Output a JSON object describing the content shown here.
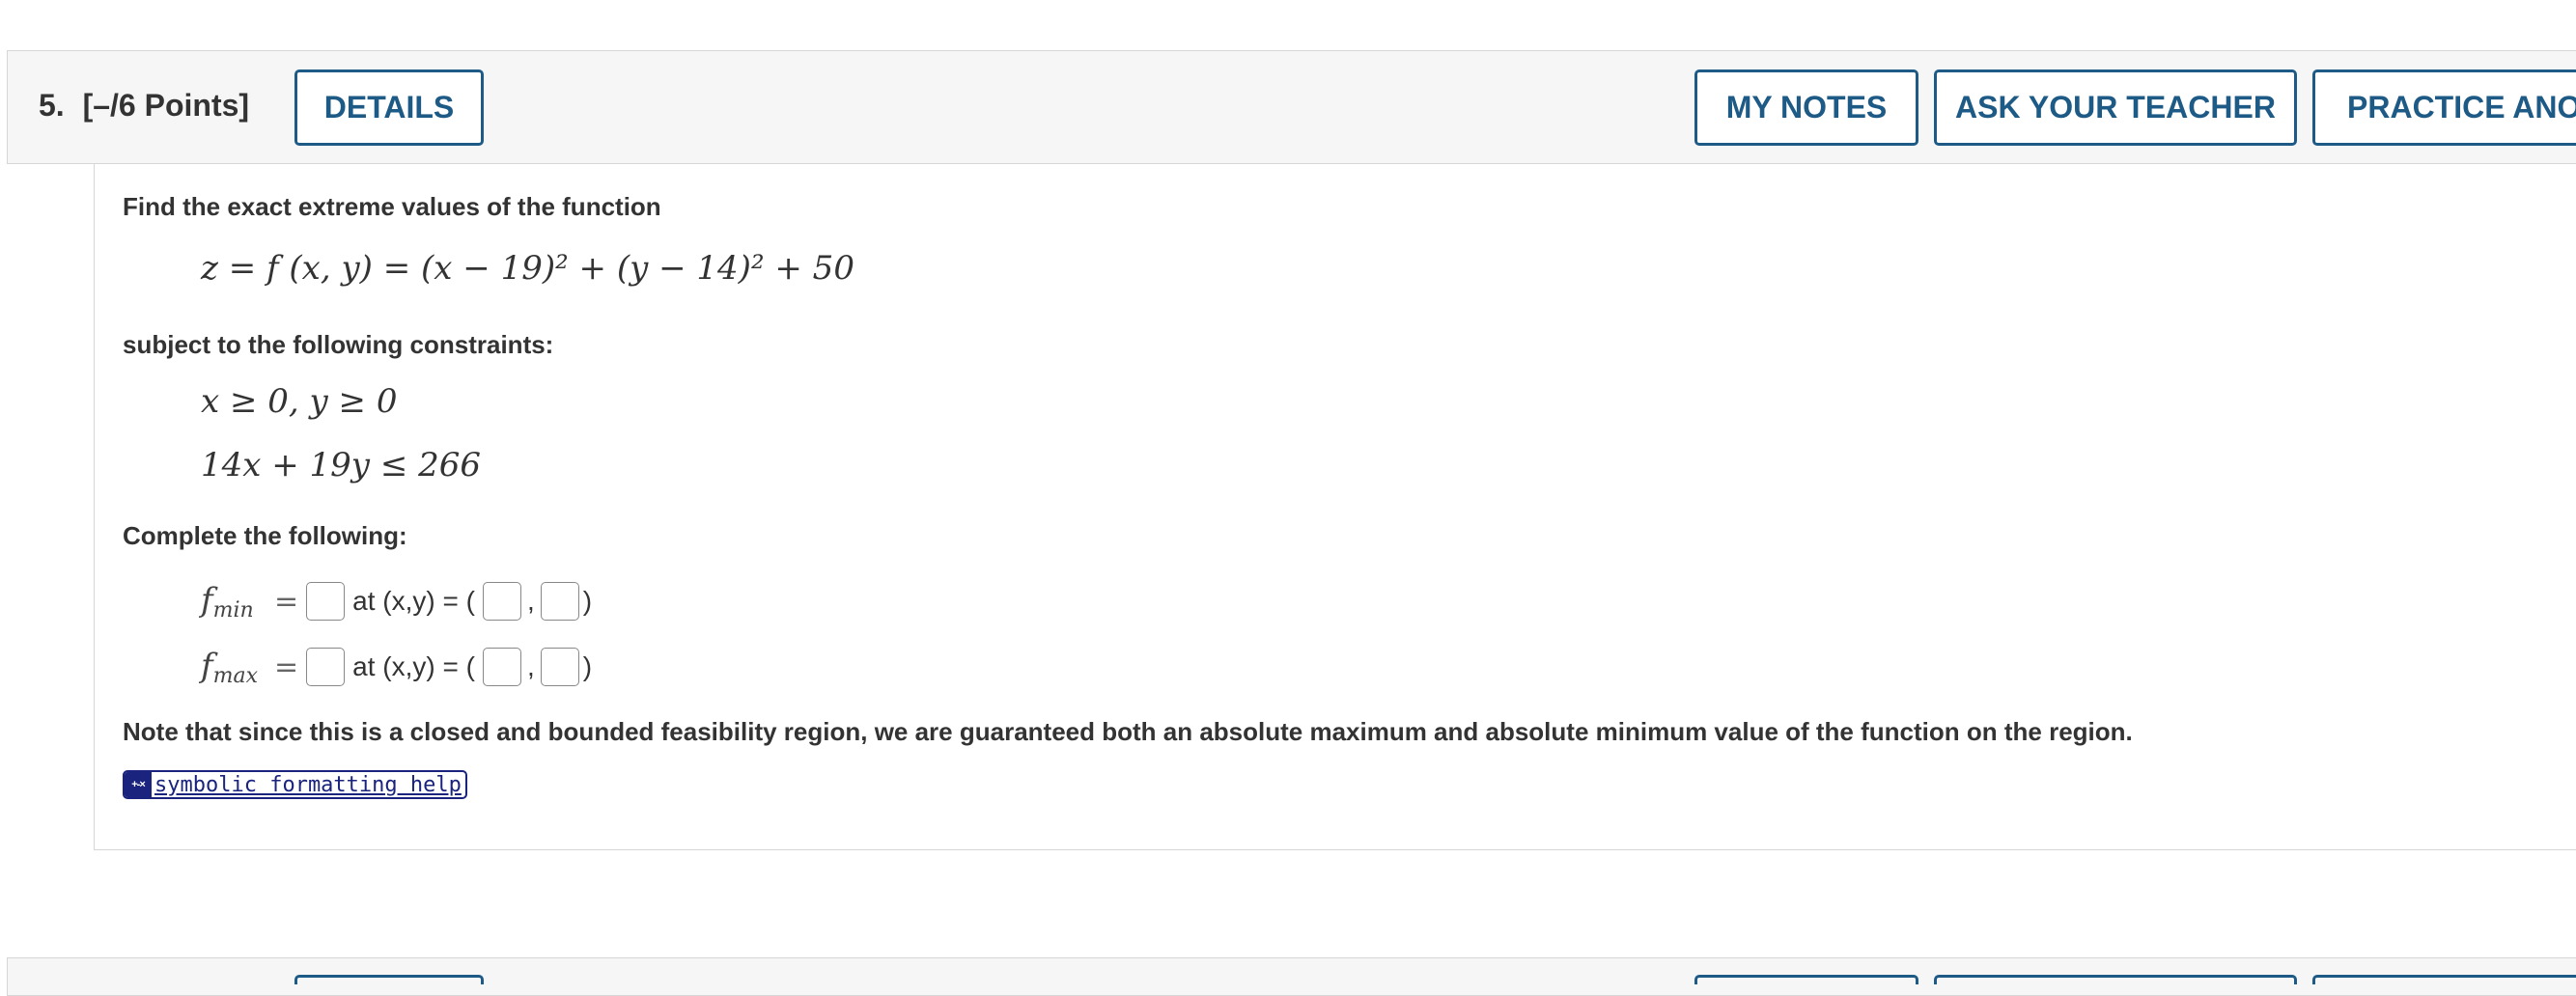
{
  "question": {
    "number_label": "5.",
    "points_label": "[–/6 Points]"
  },
  "header_buttons": {
    "details": "DETAILS",
    "my_notes": "MY NOTES",
    "ask_teacher": "ASK YOUR TEACHER",
    "practice_another": "PRACTICE ANOTHER"
  },
  "problem": {
    "intro": "Find the exact extreme values of the function",
    "function_expr": "z = f (x, y) = (x − 19)² + (y − 14)² + 50",
    "constraints_intro": "subject to the following constraints:",
    "constraint_1": "x ≥ 0, y ≥ 0",
    "constraint_2": "14x + 19y ≤ 266",
    "complete_intro": "Complete the following:",
    "note": "Note that since this is a closed and bounded feasibility region, we are guaranteed both an absolute maximum and absolute minimum value of the function on the region."
  },
  "answers": {
    "min_label": "f",
    "min_sub": "min",
    "max_label": "f",
    "max_sub": "max",
    "equals": "=",
    "at_text": "at (x,y) = (",
    "comma": ",",
    "close_paren": ")",
    "f_min_value": "",
    "x_min_value": "",
    "y_min_value": "",
    "f_max_value": "",
    "x_max_value": "",
    "y_max_value": ""
  },
  "help": {
    "icon_glyph": "+-×",
    "label": "symbolic formatting help"
  },
  "colors": {
    "button_border": "#1d5a86",
    "button_text": "#1d5a86",
    "help_accent": "#1a237e",
    "header_bg": "#f6f6f6"
  }
}
